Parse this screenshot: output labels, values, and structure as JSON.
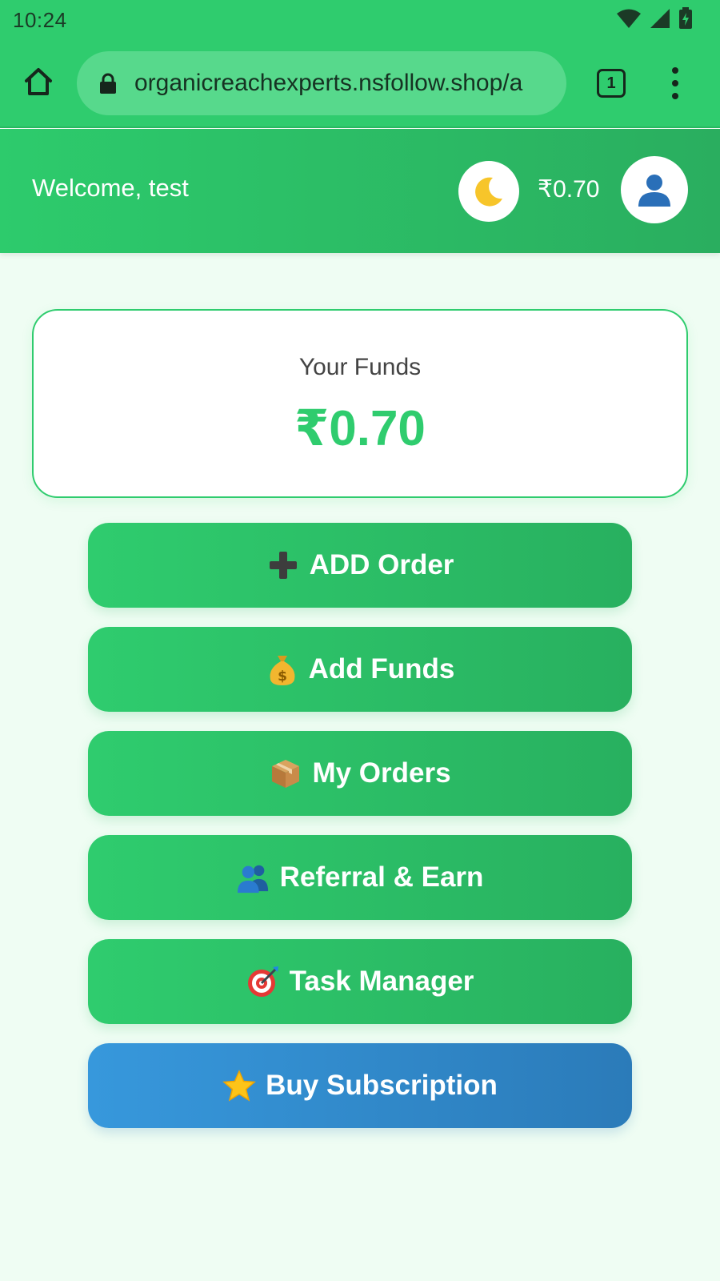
{
  "status_bar": {
    "time": "10:24"
  },
  "browser": {
    "url": "organicreachexperts.nsfollow.shop/a",
    "tab_count": "1"
  },
  "header": {
    "welcome": "Welcome, test",
    "balance": "₹0.70",
    "theme_icon": "moon-icon",
    "avatar_icon": "user-icon"
  },
  "funds": {
    "label": "Your Funds",
    "amount": "₹0.70"
  },
  "actions": [
    {
      "label": "ADD Order",
      "icon": "plus-icon"
    },
    {
      "label": "Add Funds",
      "icon": "money-bag-icon"
    },
    {
      "label": "My Orders",
      "icon": "package-icon"
    },
    {
      "label": "Referral & Earn",
      "icon": "users-icon"
    },
    {
      "label": "Task Manager",
      "icon": "target-icon"
    },
    {
      "label": "Buy Subscription",
      "icon": "star-icon"
    }
  ],
  "colors": {
    "primary_green": "#2fcc6e",
    "dark_green": "#28b05f",
    "blue": "#3798dc",
    "background": "#effdf3"
  }
}
